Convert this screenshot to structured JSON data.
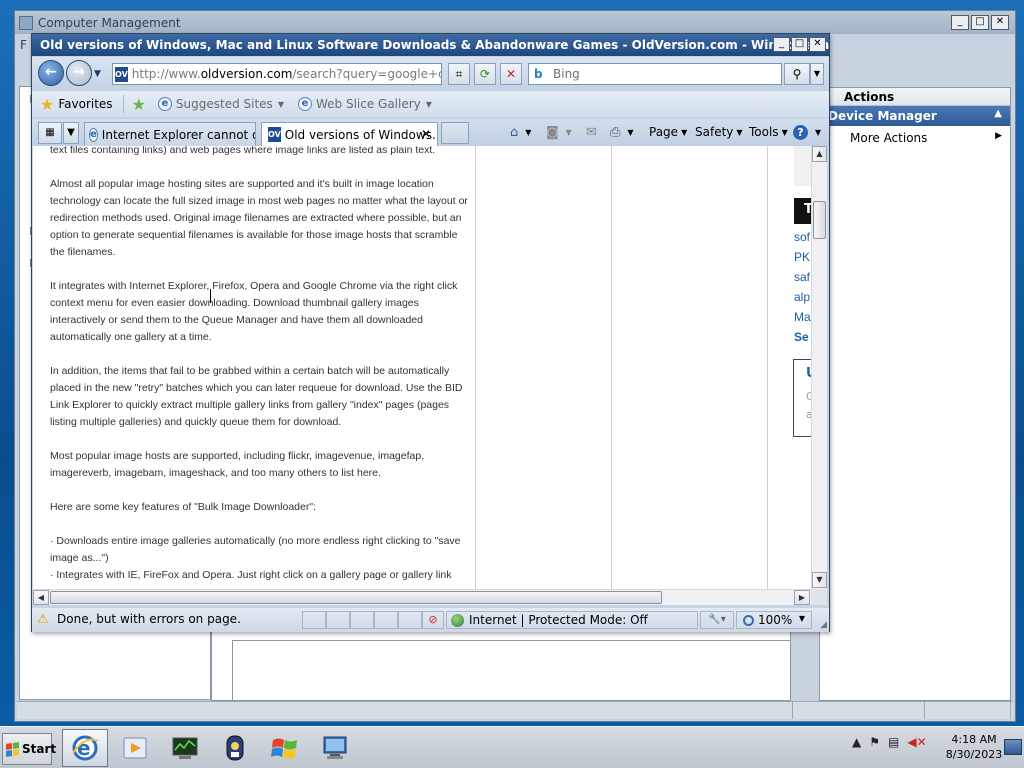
{
  "desktop": {
    "cm_window": {
      "title": "Computer Management",
      "menu_hint": "F",
      "actions_header": "Actions",
      "actions_selected": "Device Manager",
      "actions_item": "More Actions"
    }
  },
  "ie": {
    "title": "Old versions of Windows, Mac and Linux Software Downloads & Abandonware Games - OldVersion.com - Windows Internet Exp...",
    "address": {
      "prefix": "http://www.",
      "domain": "oldversion.com",
      "path": "/search?query=google+chrome",
      "badge": "OV"
    },
    "search": {
      "placeholder": "Bing",
      "icon_text": "b"
    },
    "favorites": {
      "favorites_label": "Favorites",
      "suggested": "Suggested Sites",
      "webslice": "Web Slice Gallery"
    },
    "tabs": [
      {
        "label": "Internet Explorer cannot dis..."
      },
      {
        "label": "Old versions of Windows..."
      }
    ],
    "commands": {
      "page": "Page",
      "safety": "Safety",
      "tools": "Tools"
    },
    "content": {
      "paragraphs": [
        "text files containing links) and web pages where image links are listed as plain text.",
        "Almost all popular image hosting sites are supported and it's built in image location technology can locate the full sized image in most web pages no matter what the layout or redirection methods used. Original image filenames are extracted where possible, but an option to generate sequential filenames is available for those image hosts that scramble the filenames.",
        "It integrates with Internet Explorer, Firefox, Opera and Google Chrome via the right click context menu for even easier downloading. Download thumbnail gallery images interactively or send them to the Queue Manager and have them all downloaded automatically one gallery at a time.",
        "In addition, the items that fail to be grabbed within a certain batch will be automatically placed in the new \"retry\" batches which you can later requeue for download. Use the BID Link Explorer to quickly extract multiple gallery links from gallery \"index\" pages (pages listing multiple galleries) and quickly queue them for download.",
        "Most popular image hosts are supported, including flickr, imagevenue, imagefap, imagereverb, imagebam, imageshack, and too many others to list here.",
        "Here are some key features of \"Bulk Image Downloader\":",
        "· Downloads entire image galleries automatically (no more endless right clicking to \"save image as...\")\n· Integrates with IE, FireFox and Opera. Just right click on a gallery page or gallery link"
      ],
      "sidebar": {
        "black_letter": "T",
        "links": [
          "sof",
          "PK",
          "saf",
          "alp",
          "Ma",
          "Se"
        ],
        "box_letter": "U",
        "box_grey1": "C",
        "box_grey2": "a"
      }
    },
    "status": {
      "message": "Done, but with errors on page.",
      "zone": "Internet | Protected Mode: Off",
      "zoom": "100%"
    }
  },
  "taskbar": {
    "start_label": "Start",
    "time": "4:18 AM",
    "date": "8/30/2023"
  }
}
